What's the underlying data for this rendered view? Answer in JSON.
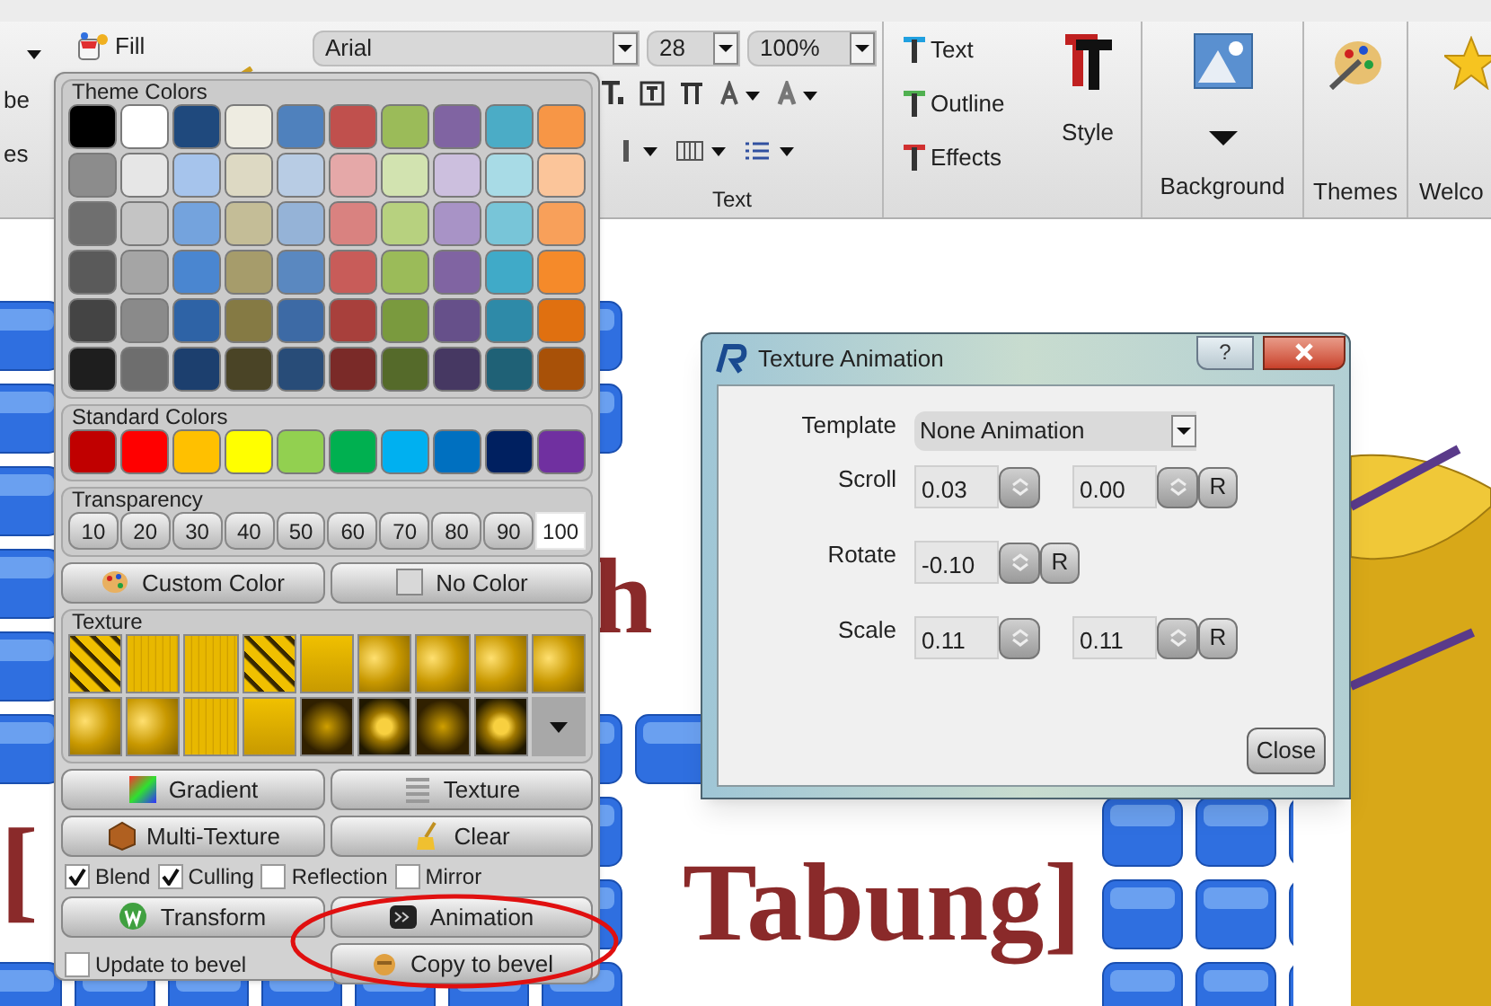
{
  "ribbon": {
    "left_items": [
      "be",
      "es"
    ],
    "fill": "Fill",
    "font": "Arial",
    "size": "28",
    "zoom": "100%",
    "text_group": "Text",
    "text_effects": [
      {
        "label": "Text",
        "kind": "text"
      },
      {
        "label": "Outline",
        "kind": "outline"
      },
      {
        "label": "Effects",
        "kind": "effects"
      }
    ],
    "style": "Style",
    "background": "Background",
    "themes": "Themes",
    "welcome": "Welco"
  },
  "scene_texts": [
    "h",
    "[",
    "Tabung]"
  ],
  "color_panel": {
    "theme_title": "Theme Colors",
    "theme_rows": [
      [
        {
          "color": "#000000"
        },
        {
          "color": "#ffffff"
        },
        {
          "color": "#1f497d"
        },
        {
          "color": "#eeece1"
        },
        {
          "color": "#4f81bd"
        },
        {
          "color": "#c0504d"
        },
        {
          "color": "#9bbb59"
        },
        {
          "color": "#8064a2"
        },
        {
          "color": "#4bacc6"
        },
        {
          "color": "#f79646"
        }
      ],
      [
        {
          "color": "#8c8c8c"
        },
        {
          "color": "#e6e6e6"
        },
        {
          "color": "#a6c4ec"
        },
        {
          "color": "#ddd9c3"
        },
        {
          "color": "#b8cce4"
        },
        {
          "color": "#e5a8a8"
        },
        {
          "color": "#d2e3b0"
        },
        {
          "color": "#ccbfde"
        },
        {
          "color": "#a8dbe6"
        },
        {
          "color": "#fbc59a"
        }
      ],
      [
        {
          "color": "#6f6f6f"
        },
        {
          "color": "#c4c4c4"
        },
        {
          "color": "#74a3dd"
        },
        {
          "color": "#c4bd97"
        },
        {
          "color": "#95b3d7"
        },
        {
          "color": "#d98280"
        },
        {
          "color": "#b7d17f"
        },
        {
          "color": "#a893c6"
        },
        {
          "color": "#78c5d8"
        },
        {
          "color": "#f8a05a"
        }
      ],
      [
        {
          "color": "#5a5a5a"
        },
        {
          "color": "#a5a5a5"
        },
        {
          "color": "#4a86d0"
        },
        {
          "color": "#a69c6b"
        },
        {
          "color": "#5a88c0"
        },
        {
          "color": "#c85c59"
        },
        {
          "color": "#9bbb59"
        },
        {
          "color": "#8064a2"
        },
        {
          "color": "#40aac8"
        },
        {
          "color": "#f58a2a"
        }
      ],
      [
        {
          "color": "#444444"
        },
        {
          "color": "#8a8a8a"
        },
        {
          "color": "#2e63a6"
        },
        {
          "color": "#857a44"
        },
        {
          "color": "#3d6aa5"
        },
        {
          "color": "#a8403c"
        },
        {
          "color": "#7a9a3e"
        },
        {
          "color": "#66508a"
        },
        {
          "color": "#2e8aa8"
        },
        {
          "color": "#e07010"
        }
      ],
      [
        {
          "color": "#1e1e1e"
        },
        {
          "color": "#6e6e6e"
        },
        {
          "color": "#1c3f6e"
        },
        {
          "color": "#4a4426"
        },
        {
          "color": "#284c78"
        },
        {
          "color": "#7a2a28"
        },
        {
          "color": "#556a2a"
        },
        {
          "color": "#463862"
        },
        {
          "color": "#1f6176"
        },
        {
          "color": "#a85108"
        }
      ]
    ],
    "standard_title": "Standard Colors",
    "standard": [
      {
        "color": "#c00000"
      },
      {
        "color": "#ff0000"
      },
      {
        "color": "#ffc000"
      },
      {
        "color": "#ffff00"
      },
      {
        "color": "#92d050"
      },
      {
        "color": "#00b050"
      },
      {
        "color": "#00b0f0"
      },
      {
        "color": "#0070c0"
      },
      {
        "color": "#002060"
      },
      {
        "color": "#7030a0"
      }
    ],
    "transparency_title": "Transparency",
    "transparency": [
      {
        "label": "10",
        "selected": false
      },
      {
        "label": "20",
        "selected": false
      },
      {
        "label": "30",
        "selected": false
      },
      {
        "label": "40",
        "selected": false
      },
      {
        "label": "50",
        "selected": false
      },
      {
        "label": "60",
        "selected": false
      },
      {
        "label": "70",
        "selected": false
      },
      {
        "label": "80",
        "selected": false
      },
      {
        "label": "90",
        "selected": false
      },
      {
        "label": "100",
        "selected": true
      }
    ],
    "custom_color": "Custom Color",
    "no_color": "No Color",
    "texture_title": "Texture",
    "textures": [
      {
        "kind": "stripes"
      },
      {
        "kind": "lines"
      },
      {
        "kind": "lines"
      },
      {
        "kind": "stripes"
      },
      {
        "kind": "plain"
      },
      {
        "kind": "swirl"
      },
      {
        "kind": "swirl"
      },
      {
        "kind": "swirl"
      },
      {
        "kind": "swirl"
      },
      {
        "kind": "swirl"
      },
      {
        "kind": "swirl"
      },
      {
        "kind": "lines"
      },
      {
        "kind": "plain"
      },
      {
        "kind": "dark"
      },
      {
        "kind": "spot"
      },
      {
        "kind": "dark"
      },
      {
        "kind": "spot"
      }
    ],
    "button_rows": [
      [
        {
          "label": "Gradient",
          "kind": "gradient"
        },
        {
          "label": "Texture",
          "kind": "texture"
        }
      ],
      [
        {
          "label": "Multi-Texture",
          "kind": "multi"
        },
        {
          "label": "Clear",
          "kind": "clear"
        }
      ]
    ],
    "options": [
      {
        "label": "Blend",
        "checked": true
      },
      {
        "label": "Culling",
        "checked": true
      },
      {
        "label": "Reflection",
        "checked": false
      },
      {
        "label": "Mirror",
        "checked": false
      }
    ],
    "lower_buttons": [
      {
        "label": "Transform",
        "kind": "transform"
      },
      {
        "label": "Animation",
        "kind": "animation"
      }
    ],
    "update_to_bevel": {
      "label": "Update to bevel",
      "checked": false
    },
    "copy_to_bevel": "Copy to bevel"
  },
  "dialog": {
    "title": "Texture Animation",
    "help": "?",
    "fields": [
      {
        "label": "Template",
        "kind": "dropdown",
        "value": "None Animation"
      },
      {
        "label": "Scroll",
        "kind": "spin",
        "values": [
          "0.03",
          "0.00"
        ],
        "reset": "R"
      },
      {
        "label": "Rotate",
        "kind": "spin",
        "values": [
          "-0.10"
        ],
        "reset": "R"
      },
      {
        "label": "Scale",
        "kind": "spin",
        "values": [
          "0.11",
          "0.11"
        ],
        "reset": "R"
      }
    ],
    "close": "Close"
  }
}
